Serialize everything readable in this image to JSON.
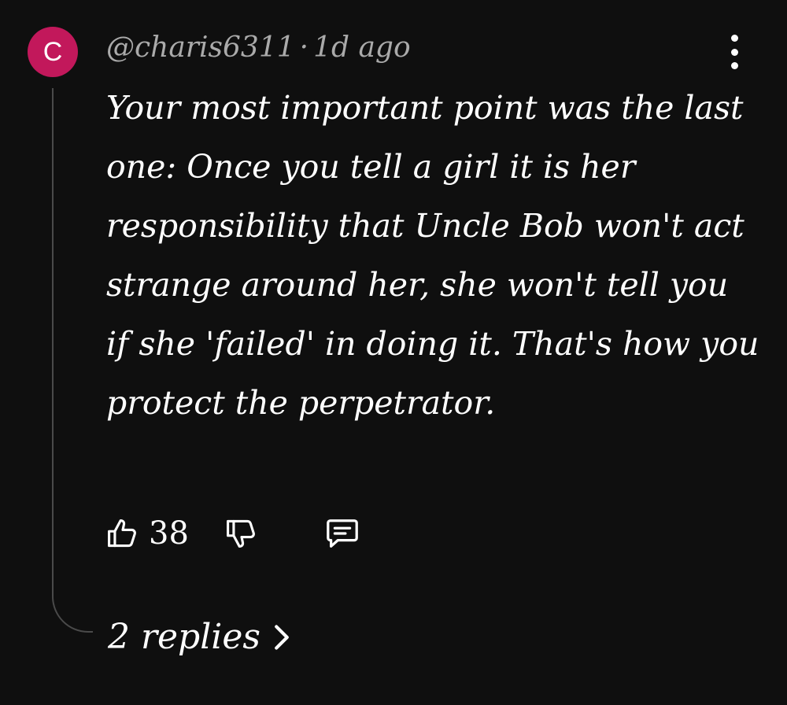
{
  "comment": {
    "avatar_letter": "C",
    "avatar_color": "#c2185b",
    "author": "@charis6311",
    "separator": "·",
    "timestamp": "1d ago",
    "text": "Your most important point was the last one: Once you tell a girl it is her responsibility that Uncle Bob won't act strange around her, she won't tell you if she 'failed' in doing it. That's how you protect the perpetrator.",
    "like_count": "38",
    "replies_label": "2 replies"
  },
  "icons": {
    "menu": "more-vert-icon",
    "like": "thumbs-up-icon",
    "dislike": "thumbs-down-icon",
    "reply": "comment-icon",
    "replies_chevron": "chevron-right-icon"
  },
  "colors": {
    "background": "#0f0f0f",
    "text": "#ffffff",
    "meta_text": "#aaaaaa",
    "thread_line": "#4a4a4a"
  }
}
